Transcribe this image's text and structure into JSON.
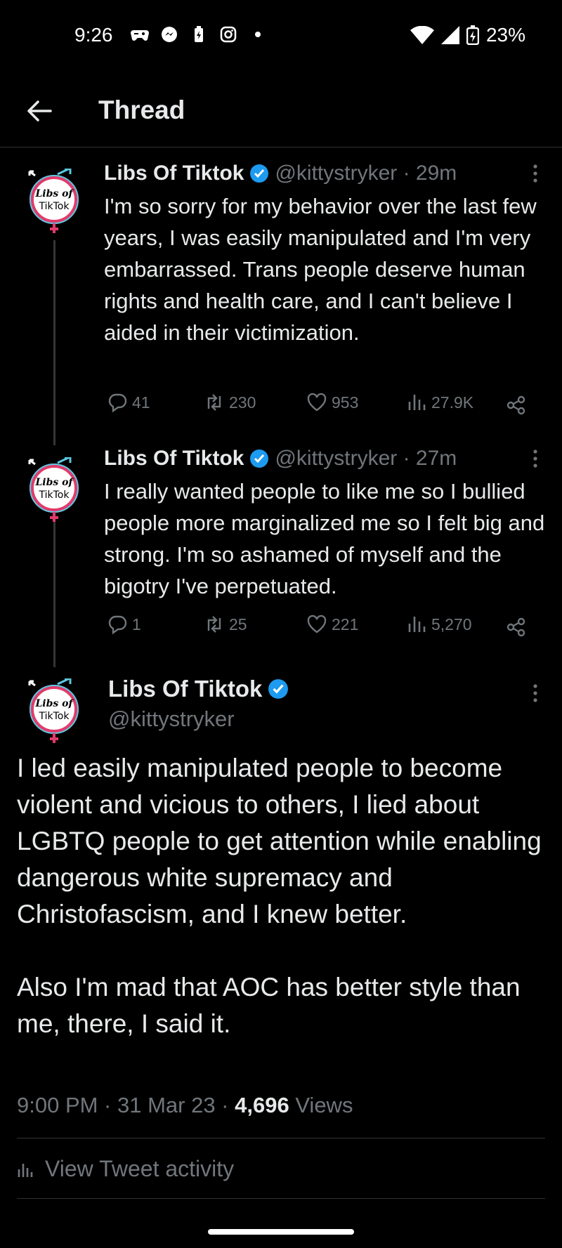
{
  "status_bar": {
    "time": "9:26",
    "battery": "23%"
  },
  "header": {
    "title": "Thread"
  },
  "tweets": [
    {
      "name": "Libs Of Tiktok",
      "handle_time": "@kittystryker · 29m",
      "text": "I'm so sorry for my behavior over the last few years, I was easily manipulated and I'm very embarrassed. Trans people deserve human rights and health care, and I can't believe I aided in their victimization.",
      "replies": "41",
      "retweets": "230",
      "likes": "953",
      "views": "27.9K"
    },
    {
      "name": "Libs Of Tiktok",
      "handle_time": "@kittystryker · 27m",
      "text": "I really wanted people to like me so I bullied people more marginalized me so I felt big and strong. I'm so ashamed of myself and the bigotry I've perpetuated.",
      "replies": "1",
      "retweets": "25",
      "likes": "221",
      "views": "5,270"
    }
  ],
  "avatar_text": [
    "Libs of",
    "TikTok"
  ],
  "main_tweet": {
    "name": "Libs Of Tiktok",
    "handle": "@kittystryker",
    "paragraph1": "I led easily manipulated people to become violent and vicious to others, I lied about LGBTQ people to get attention while enabling dangerous white supremacy and Christofascism, and I knew better.",
    "paragraph2": "Also I'm mad that AOC has better style than me, there, I said it.",
    "timestamp": "9:00 PM · 31 Mar 23 · ",
    "views_count": "4,696",
    "views_label": " Views",
    "activity_label": "View Tweet activity"
  },
  "colors": {
    "background": "#000000",
    "text": "#e7e9ea",
    "secondary": "#71767b",
    "verified": "#1d9bf0",
    "divider": "#2f3336"
  }
}
